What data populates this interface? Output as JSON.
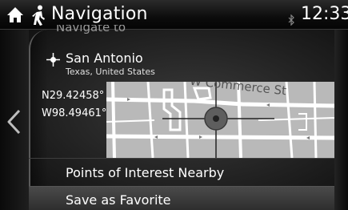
{
  "header": {
    "title": "Navigation",
    "clock": "12:33",
    "home_icon": "home-icon",
    "nav_mode_icon": "pedestrian-icon",
    "bluetooth_icon": "bluetooth-icon"
  },
  "list": {
    "partial_item_label": "Navigate to",
    "destination": {
      "name": "San Antonio",
      "region": "Texas, United States",
      "latitude": "N29.42458°",
      "longitude": "W98.49461°"
    },
    "map": {
      "street_label": "W Commerce St"
    },
    "items": [
      {
        "label": "Points of Interest Nearby"
      },
      {
        "label": "Save as Favorite"
      }
    ]
  },
  "colors": {
    "background": "#000000",
    "map_background": "#b9b9b9",
    "text": "#ffffff"
  }
}
